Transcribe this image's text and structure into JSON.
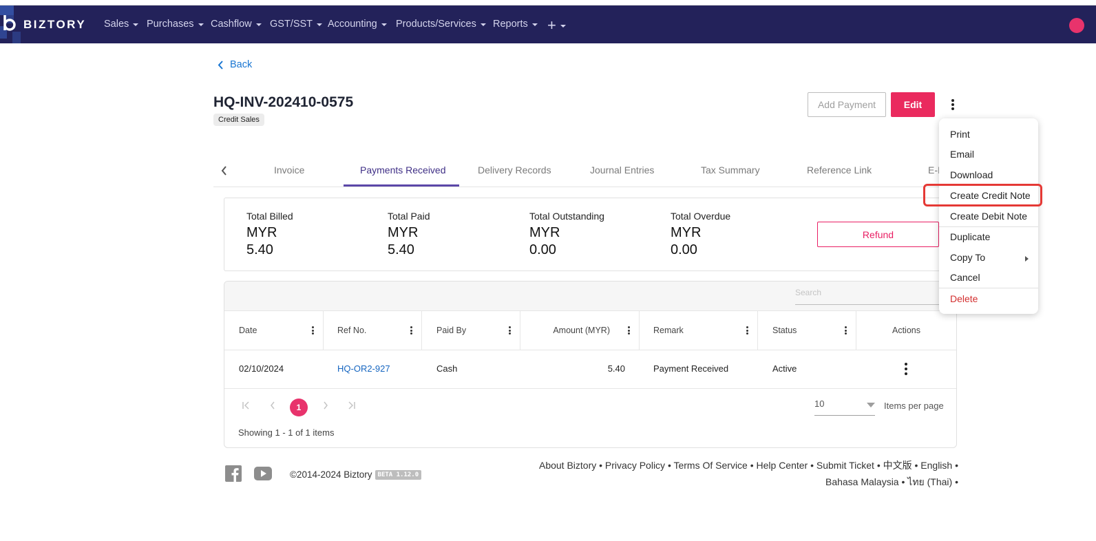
{
  "nav": {
    "logo": "BIZTORY",
    "items": [
      "Sales",
      "Purchases",
      "Cashflow",
      "GST/SST",
      "Accounting",
      "Products/Services",
      "Reports"
    ],
    "plus": "+"
  },
  "back_label": "Back",
  "doc": {
    "number": "HQ-INV-202410-0575",
    "type_chip": "Credit Sales"
  },
  "actions": {
    "add_payment": "Add Payment",
    "edit": "Edit"
  },
  "tabs": [
    "Invoice",
    "Payments Received",
    "Delivery Records",
    "Journal Entries",
    "Tax Summary",
    "Reference Link",
    "E-I"
  ],
  "active_tab": "Payments Received",
  "summary": {
    "billed": {
      "label": "Total Billed",
      "currency": "MYR",
      "value": "5.40"
    },
    "paid": {
      "label": "Total Paid",
      "currency": "MYR",
      "value": "5.40"
    },
    "outstanding": {
      "label": "Total Outstanding",
      "currency": "MYR",
      "value": "0.00"
    },
    "overdue": {
      "label": "Total Overdue",
      "currency": "MYR",
      "value": "0.00"
    },
    "refund": "Refund"
  },
  "grid": {
    "search_placeholder": "Search",
    "columns": [
      "Date",
      "Ref No.",
      "Paid By",
      "Amount (MYR)",
      "Remark",
      "Status",
      "Actions"
    ],
    "rows": [
      {
        "date": "02/10/2024",
        "ref": "HQ-OR2-927",
        "paid_by": "Cash",
        "amount": "5.40",
        "remark": "Payment Received",
        "status": "Active"
      }
    ],
    "current_page": "1",
    "per_page": "10",
    "per_page_label": "Items per page",
    "showing": "Showing 1 - 1 of 1 items"
  },
  "footer": {
    "copyright": "©2014-2024 Biztory",
    "beta": "BETA 1.12.0",
    "links_line1": "About Biztory • Privacy Policy • Terms Of Service • Help Center • Submit Ticket • 中文版 • English •",
    "links_line2": "Bahasa Malaysia • ไทย (Thai) •"
  },
  "menu": {
    "items": [
      "Print",
      "Email",
      "Download",
      "Create Credit Note",
      "Create Debit Note",
      "Duplicate",
      "Copy To",
      "Cancel",
      "Delete"
    ],
    "highlighted": "Create Credit Note"
  },
  "colors": {
    "navbar": "#23225a",
    "accent": "#ea2a5e",
    "tab_active": "#5b47a8",
    "link": "#1976d2"
  }
}
